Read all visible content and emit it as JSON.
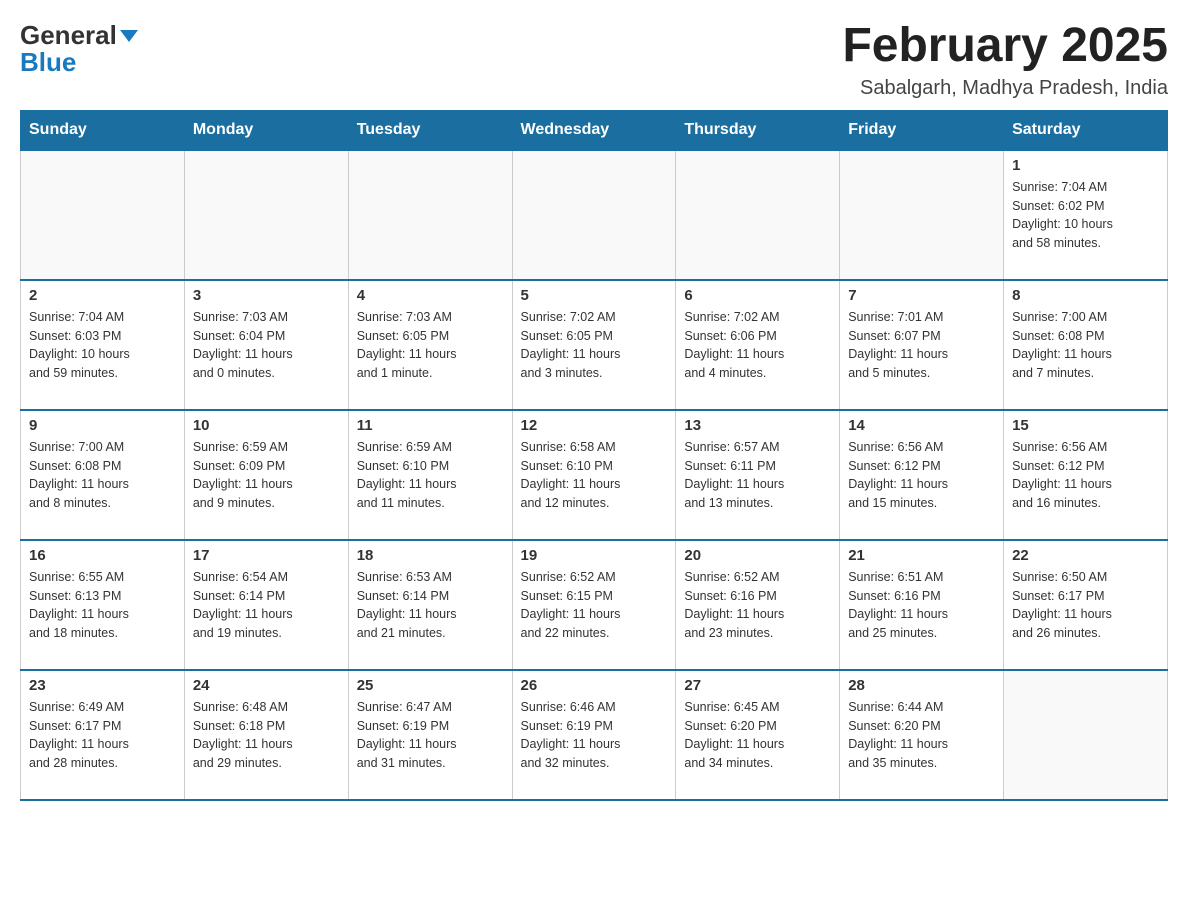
{
  "header": {
    "logo": {
      "line1": "General",
      "line2": "Blue"
    },
    "title": "February 2025",
    "subtitle": "Sabalgarh, Madhya Pradesh, India"
  },
  "days_of_week": [
    "Sunday",
    "Monday",
    "Tuesday",
    "Wednesday",
    "Thursday",
    "Friday",
    "Saturday"
  ],
  "weeks": [
    [
      {
        "day": "",
        "info": ""
      },
      {
        "day": "",
        "info": ""
      },
      {
        "day": "",
        "info": ""
      },
      {
        "day": "",
        "info": ""
      },
      {
        "day": "",
        "info": ""
      },
      {
        "day": "",
        "info": ""
      },
      {
        "day": "1",
        "info": "Sunrise: 7:04 AM\nSunset: 6:02 PM\nDaylight: 10 hours\nand 58 minutes."
      }
    ],
    [
      {
        "day": "2",
        "info": "Sunrise: 7:04 AM\nSunset: 6:03 PM\nDaylight: 10 hours\nand 59 minutes."
      },
      {
        "day": "3",
        "info": "Sunrise: 7:03 AM\nSunset: 6:04 PM\nDaylight: 11 hours\nand 0 minutes."
      },
      {
        "day": "4",
        "info": "Sunrise: 7:03 AM\nSunset: 6:05 PM\nDaylight: 11 hours\nand 1 minute."
      },
      {
        "day": "5",
        "info": "Sunrise: 7:02 AM\nSunset: 6:05 PM\nDaylight: 11 hours\nand 3 minutes."
      },
      {
        "day": "6",
        "info": "Sunrise: 7:02 AM\nSunset: 6:06 PM\nDaylight: 11 hours\nand 4 minutes."
      },
      {
        "day": "7",
        "info": "Sunrise: 7:01 AM\nSunset: 6:07 PM\nDaylight: 11 hours\nand 5 minutes."
      },
      {
        "day": "8",
        "info": "Sunrise: 7:00 AM\nSunset: 6:08 PM\nDaylight: 11 hours\nand 7 minutes."
      }
    ],
    [
      {
        "day": "9",
        "info": "Sunrise: 7:00 AM\nSunset: 6:08 PM\nDaylight: 11 hours\nand 8 minutes."
      },
      {
        "day": "10",
        "info": "Sunrise: 6:59 AM\nSunset: 6:09 PM\nDaylight: 11 hours\nand 9 minutes."
      },
      {
        "day": "11",
        "info": "Sunrise: 6:59 AM\nSunset: 6:10 PM\nDaylight: 11 hours\nand 11 minutes."
      },
      {
        "day": "12",
        "info": "Sunrise: 6:58 AM\nSunset: 6:10 PM\nDaylight: 11 hours\nand 12 minutes."
      },
      {
        "day": "13",
        "info": "Sunrise: 6:57 AM\nSunset: 6:11 PM\nDaylight: 11 hours\nand 13 minutes."
      },
      {
        "day": "14",
        "info": "Sunrise: 6:56 AM\nSunset: 6:12 PM\nDaylight: 11 hours\nand 15 minutes."
      },
      {
        "day": "15",
        "info": "Sunrise: 6:56 AM\nSunset: 6:12 PM\nDaylight: 11 hours\nand 16 minutes."
      }
    ],
    [
      {
        "day": "16",
        "info": "Sunrise: 6:55 AM\nSunset: 6:13 PM\nDaylight: 11 hours\nand 18 minutes."
      },
      {
        "day": "17",
        "info": "Sunrise: 6:54 AM\nSunset: 6:14 PM\nDaylight: 11 hours\nand 19 minutes."
      },
      {
        "day": "18",
        "info": "Sunrise: 6:53 AM\nSunset: 6:14 PM\nDaylight: 11 hours\nand 21 minutes."
      },
      {
        "day": "19",
        "info": "Sunrise: 6:52 AM\nSunset: 6:15 PM\nDaylight: 11 hours\nand 22 minutes."
      },
      {
        "day": "20",
        "info": "Sunrise: 6:52 AM\nSunset: 6:16 PM\nDaylight: 11 hours\nand 23 minutes."
      },
      {
        "day": "21",
        "info": "Sunrise: 6:51 AM\nSunset: 6:16 PM\nDaylight: 11 hours\nand 25 minutes."
      },
      {
        "day": "22",
        "info": "Sunrise: 6:50 AM\nSunset: 6:17 PM\nDaylight: 11 hours\nand 26 minutes."
      }
    ],
    [
      {
        "day": "23",
        "info": "Sunrise: 6:49 AM\nSunset: 6:17 PM\nDaylight: 11 hours\nand 28 minutes."
      },
      {
        "day": "24",
        "info": "Sunrise: 6:48 AM\nSunset: 6:18 PM\nDaylight: 11 hours\nand 29 minutes."
      },
      {
        "day": "25",
        "info": "Sunrise: 6:47 AM\nSunset: 6:19 PM\nDaylight: 11 hours\nand 31 minutes."
      },
      {
        "day": "26",
        "info": "Sunrise: 6:46 AM\nSunset: 6:19 PM\nDaylight: 11 hours\nand 32 minutes."
      },
      {
        "day": "27",
        "info": "Sunrise: 6:45 AM\nSunset: 6:20 PM\nDaylight: 11 hours\nand 34 minutes."
      },
      {
        "day": "28",
        "info": "Sunrise: 6:44 AM\nSunset: 6:20 PM\nDaylight: 11 hours\nand 35 minutes."
      },
      {
        "day": "",
        "info": ""
      }
    ]
  ]
}
